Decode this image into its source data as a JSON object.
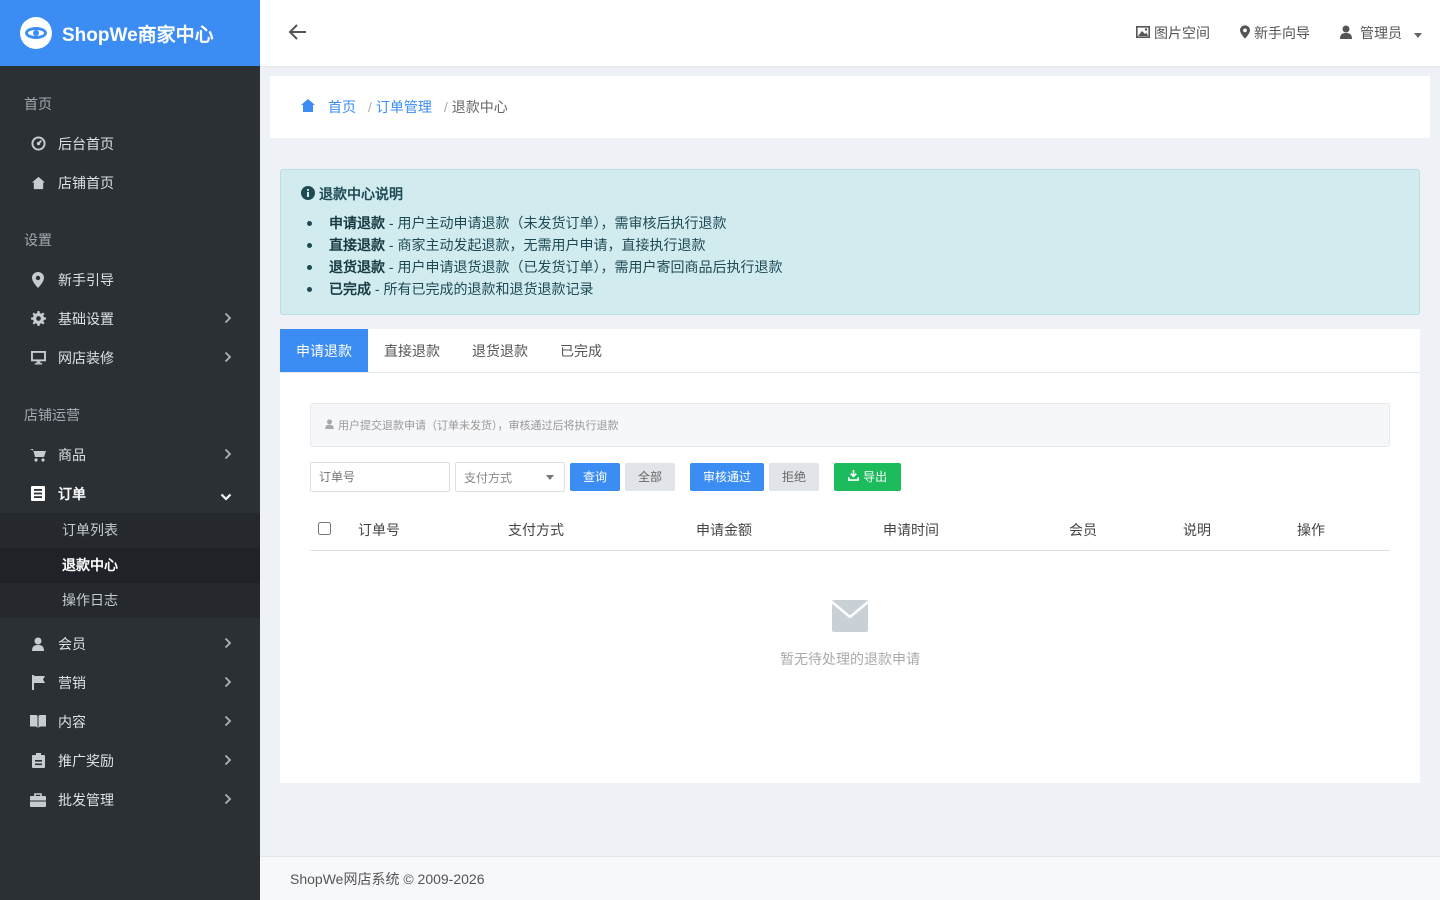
{
  "brand": {
    "name": "ShopWe商家中心"
  },
  "topbar": {
    "links": [
      {
        "label": "图片空间",
        "icon": "image-icon"
      },
      {
        "label": "新手向导",
        "icon": "map-marker-icon"
      },
      {
        "label": "管理员",
        "icon": "user-icon"
      }
    ]
  },
  "sidebar": {
    "sections": [
      {
        "title": "首页",
        "items": [
          {
            "label": "后台首页",
            "icon": "dashboard-icon"
          },
          {
            "label": "店铺首页",
            "icon": "home-icon"
          }
        ]
      },
      {
        "title": "设置",
        "items": [
          {
            "label": "新手引导",
            "icon": "map-marker-icon"
          },
          {
            "label": "基础设置",
            "icon": "gear-icon"
          },
          {
            "label": "网店装修",
            "icon": "monitor-icon"
          }
        ]
      },
      {
        "title": "店铺运营",
        "items": [
          {
            "label": "商品",
            "icon": "cart-icon"
          },
          {
            "label": "订单",
            "icon": "order-icon"
          }
        ]
      }
    ],
    "order_sub": [
      "订单列表",
      "退款中心",
      "操作日志"
    ],
    "more": [
      {
        "label": "会员",
        "icon": "user-icon"
      },
      {
        "label": "营销",
        "icon": "flag-icon"
      },
      {
        "label": "内容",
        "icon": "book-icon"
      },
      {
        "label": "推广奖励",
        "icon": "clipboard-icon"
      },
      {
        "label": "批发管理",
        "icon": "briefcase-icon"
      }
    ]
  },
  "breadcrumb": {
    "home": "首页",
    "level1": "订单管理",
    "current": "退款中心"
  },
  "info": {
    "title": "退款中心说明",
    "items": [
      {
        "term": "申请退款",
        "desc": " - 用户主动申请退款（未发货订单），需审核后执行退款"
      },
      {
        "term": "直接退款",
        "desc": " - 商家主动发起退款，无需用户申请，直接执行退款"
      },
      {
        "term": "退货退款",
        "desc": " - 用户申请退货退款（已发货订单），需用户寄回商品后执行退款"
      },
      {
        "term": "已完成",
        "desc": " - 所有已完成的退款和退货退款记录"
      }
    ]
  },
  "tabs": [
    "申请退款",
    "直接退款",
    "退货退款",
    "已完成"
  ],
  "tip": "用户提交退款申请（订单未发货），审核通过后将执行退款",
  "filters": {
    "order_placeholder": "订单号",
    "payment_value": "支付方式",
    "query": "查询",
    "all": "全部",
    "approve": "审核通过",
    "reject": "拒绝",
    "export": "导出"
  },
  "table": {
    "columns": [
      "订单号",
      "支付方式",
      "申请金额",
      "申请时间",
      "会员",
      "说明",
      "操作"
    ]
  },
  "empty_text": "暂无待处理的退款申请",
  "footer": "ShopWe网店系统 © 2009-2026",
  "colors": {
    "primary": "#3b8df4",
    "sidebar": "#2b3035",
    "success": "#1cbb5c",
    "info_bg": "#d1ebef"
  }
}
